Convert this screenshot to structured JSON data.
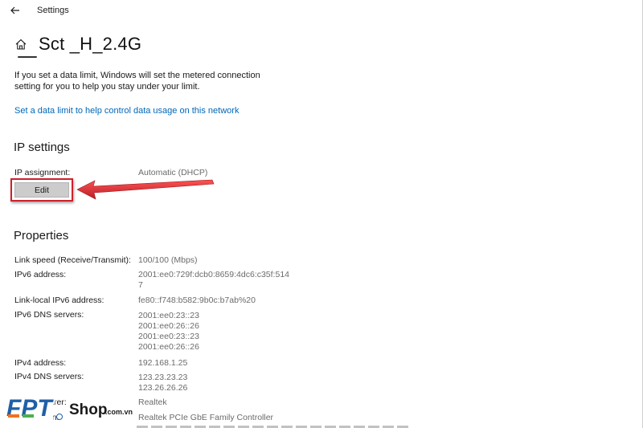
{
  "titlebar": {
    "app_title": "Settings"
  },
  "header": {
    "title": "Sct _H_2.4G"
  },
  "data_limit": {
    "description": "If you set a data limit, Windows will set the metered connection setting for you to help you stay under your limit.",
    "link": "Set a data limit to help control data usage on this network"
  },
  "ip_settings": {
    "heading": "IP settings",
    "assignment_label": "IP assignment:",
    "assignment_value": "Automatic (DHCP)",
    "edit_label": "Edit"
  },
  "properties": {
    "heading": "Properties",
    "rows": [
      {
        "label": "Link speed (Receive/Transmit):",
        "value": "100/100 (Mbps)"
      },
      {
        "label": "IPv6 address:",
        "value": "2001:ee0:729f:dcb0:8659:4dc6:c35f:514\n7"
      },
      {
        "label": "Link-local IPv6 address:",
        "value": "fe80::f748:b582:9b0c:b7ab%20"
      },
      {
        "label": "IPv6 DNS servers:",
        "value": "2001:ee0:23::23\n2001:ee0:26::26\n2001:ee0:23::23\n2001:ee0:26::26"
      },
      {
        "label": "IPv4 address:",
        "value": "192.168.1.25"
      },
      {
        "label": "IPv4 DNS servers:",
        "value": "123.23.23.23\n123.26.26.26"
      },
      {
        "label": "Manufacturer:",
        "value": "Realtek"
      },
      {
        "label": "Description:",
        "value": "Realtek PCIe GbE Family Controller"
      }
    ]
  },
  "watermark": {
    "brand": "FPT",
    "shop": "Shop",
    "domain": ".com.vn"
  },
  "colors": {
    "link": "#0067b8",
    "highlight": "#d0202a",
    "logo_blue": "#1f5fa8",
    "logo_orange": "#f37021",
    "logo_green": "#4caf50"
  },
  "icons": {
    "back": "back-arrow-icon",
    "home": "home-icon",
    "annotation": "red-arrow-icon"
  }
}
